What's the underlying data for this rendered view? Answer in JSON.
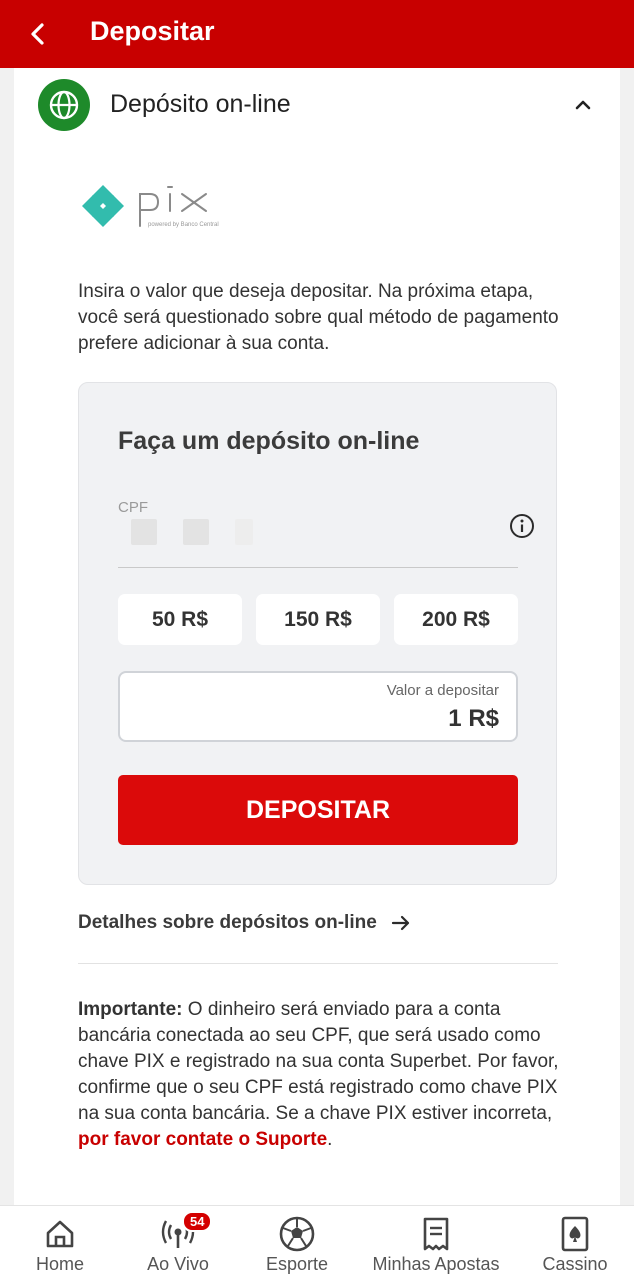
{
  "header": {
    "title": "Depositar"
  },
  "accordion": {
    "title": "Depósito on-line"
  },
  "pix_logo": {
    "text": "pix",
    "subtext": "powered by Banco Central"
  },
  "intro_text": "Insira o valor que deseja depositar. Na próxima etapa, você será questionado sobre qual método de pagamento prefere adicionar à sua conta.",
  "form": {
    "title": "Faça um depósito on-line",
    "cpf_label": "CPF",
    "amount_options": [
      "50 R$",
      "150 R$",
      "200 R$"
    ],
    "value_label": "Valor a depositar",
    "value_amount": "1 R$",
    "deposit_button": "DEPOSITAR"
  },
  "details_link": "Detalhes sobre depósitos on-line",
  "important": {
    "label": "Importante:",
    "text": " O dinheiro será enviado para a conta bancária conectada ao seu CPF, que será usado como chave PIX e registrado na sua conta Superbet. Por favor, confirme que o seu CPF está registrado como chave PIX na sua conta bancária. Se a chave PIX estiver incorreta, ",
    "link": "por favor contate o Suporte",
    "end": "."
  },
  "nav": {
    "items": [
      {
        "label": "Home",
        "icon": "home-icon"
      },
      {
        "label": "Ao Vivo",
        "icon": "live-broadcast-icon",
        "badge": "54"
      },
      {
        "label": "Esporte",
        "icon": "soccer-ball-icon"
      },
      {
        "label": "Minhas Apostas",
        "icon": "receipt-icon"
      },
      {
        "label": "Cassino",
        "icon": "spade-card-icon"
      }
    ]
  },
  "colors": {
    "brand_red": "#c80000",
    "button_red": "#db0a0a",
    "globe_green": "#1e8a2a",
    "pix_teal": "#32bcad"
  }
}
